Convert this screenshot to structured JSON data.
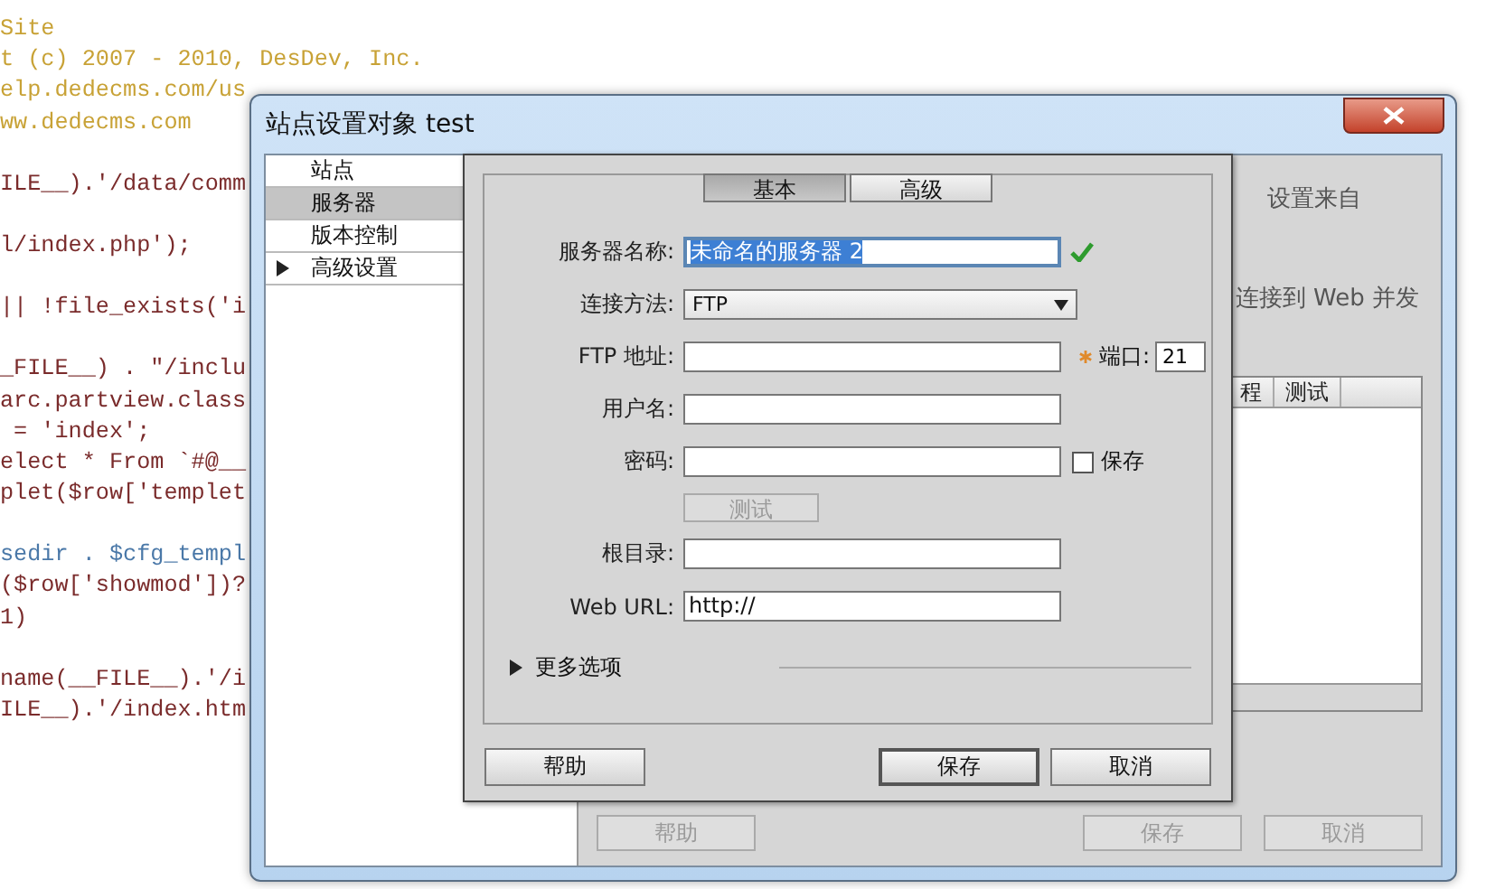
{
  "editor": {
    "blocks": [
      {
        "lines": [
          {
            "text": "Site",
            "kind": "comment"
          },
          {
            "text": "t (c) 2007 - 2010, DesDev, Inc.",
            "kind": "comment"
          },
          {
            "text": "elp.dedecms.com/us",
            "kind": "comment"
          },
          {
            "text": "ww.dedecms.com",
            "kind": "comment"
          }
        ]
      },
      {
        "lines": [
          {
            "text": "ILE__).'/data/comm",
            "kind": "code"
          }
        ]
      },
      {
        "lines": [
          {
            "text": "l/index.php');",
            "kind": "code"
          }
        ]
      },
      {
        "lines": [
          {
            "text": "|| !file_exists('i",
            "kind": "code"
          }
        ]
      },
      {
        "lines": [
          {
            "text": "_FILE__) . \"/inclu",
            "kind": "code"
          },
          {
            "text": "arc.partview.class",
            "kind": "code"
          },
          {
            "text": " = 'index';",
            "kind": "code"
          },
          {
            "text": "elect * From `#@__",
            "kind": "code"
          },
          {
            "text": "plet($row['templet",
            "kind": "code"
          }
        ]
      },
      {
        "lines": [
          {
            "text": "sedir . $cfg_templ",
            "kind": "variable"
          },
          {
            "text": "($row['showmod'])?",
            "kind": "code"
          },
          {
            "text": "1)",
            "kind": "code"
          }
        ]
      },
      {
        "lines": [
          {
            "text": "name(__FILE__).'/i",
            "kind": "code"
          },
          {
            "text": "ILE__).'/index.htm",
            "kind": "code"
          }
        ]
      }
    ]
  },
  "window": {
    "title": "站点设置对象 test"
  },
  "sidebar": {
    "items": [
      {
        "label": "站点",
        "selected": false,
        "expandable": false
      },
      {
        "label": "服务器",
        "selected": true,
        "expandable": false
      },
      {
        "label": "版本控制",
        "selected": false,
        "expandable": false
      },
      {
        "label": "高级设置",
        "selected": false,
        "expandable": true
      }
    ]
  },
  "panel": {
    "text_1": "设置来自",
    "text_2": "连接到 Web 并发",
    "table": {
      "columns": [
        "程",
        "测试"
      ]
    },
    "buttons": [
      {
        "label": "帮助",
        "disabled": true
      },
      {
        "label": "保存",
        "disabled": true
      },
      {
        "label": "取消",
        "disabled": true
      }
    ]
  },
  "dialog": {
    "tabs": [
      {
        "label": "基本",
        "selected": true
      },
      {
        "label": "高级",
        "selected": false
      }
    ],
    "fields": [
      {
        "kind": "input",
        "label": "服务器名称:",
        "value": "未命名的服务器 2",
        "highlighted": true,
        "valid": true
      },
      {
        "kind": "select",
        "label": "连接方法:",
        "value": "FTP"
      },
      {
        "kind": "input",
        "label": "FTP 地址:",
        "port": {
          "label": "端口:",
          "value": "21",
          "required": true
        }
      },
      {
        "kind": "input",
        "label": "用户名:"
      },
      {
        "kind": "input",
        "label": "密码:",
        "remember": {
          "label": "保存",
          "checked": false
        }
      },
      {
        "kind": "button",
        "label": "测试",
        "disabled": true
      },
      {
        "kind": "input",
        "label": "根目录:"
      },
      {
        "kind": "input",
        "label": "Web URL:",
        "value": "http://"
      }
    ],
    "more_options": {
      "label": "更多选项",
      "expanded": false
    },
    "buttons": [
      {
        "label": "帮助",
        "default": false
      },
      {
        "label": "保存",
        "default": true
      },
      {
        "label": "取消",
        "default": false
      }
    ]
  }
}
